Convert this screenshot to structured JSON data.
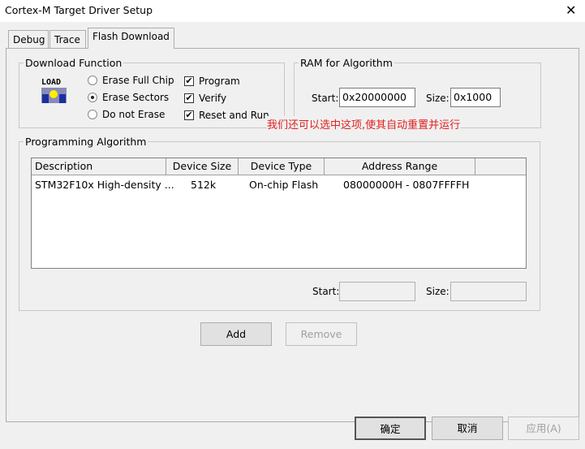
{
  "window": {
    "title": "Cortex-M Target Driver Setup",
    "close": "✕"
  },
  "tabs": [
    {
      "label": "Debug"
    },
    {
      "label": "Trace"
    },
    {
      "label": "Flash Download"
    }
  ],
  "download_function": {
    "legend": "Download Function",
    "icon_text": "LOAD",
    "erase_options": [
      {
        "label": "Erase Full Chip",
        "selected": false
      },
      {
        "label": "Erase Sectors",
        "selected": true
      },
      {
        "label": "Do not Erase",
        "selected": false
      }
    ],
    "checks": [
      {
        "label": "Program",
        "checked": true
      },
      {
        "label": "Verify",
        "checked": true
      },
      {
        "label": "Reset and Run",
        "checked": true
      }
    ]
  },
  "ram": {
    "legend": "RAM for Algorithm",
    "start_label": "Start:",
    "start_value": "0x20000000",
    "size_label": "Size:",
    "size_value": "0x1000"
  },
  "annotation": {
    "text": "我们还可以选中这项,使其自动重置并运行",
    "color": "#e02020"
  },
  "algorithm": {
    "legend": "Programming Algorithm",
    "columns": [
      "Description",
      "Device Size",
      "Device Type",
      "Address Range"
    ],
    "rows": [
      {
        "description": "STM32F10x High-density ...",
        "size": "512k",
        "type": "On-chip Flash",
        "range": "08000000H - 0807FFFFH"
      }
    ],
    "start_label": "Start:",
    "start_value": "",
    "size_label": "Size:",
    "size_value": ""
  },
  "buttons": {
    "add": "Add",
    "remove": "Remove",
    "ok": "确定",
    "cancel": "取消",
    "apply": "应用(A)"
  }
}
